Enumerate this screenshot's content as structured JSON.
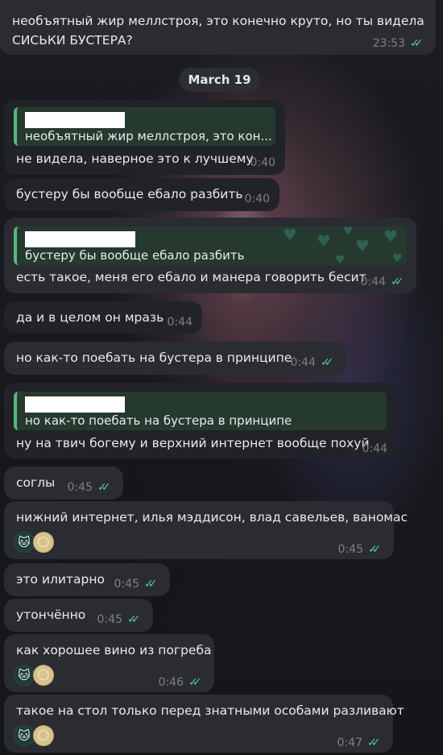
{
  "messages": [
    {
      "text_line1": "необъятный жир меллстроя, это конечно круто, но ты видела",
      "text_line2": "СИСЬКИ БУСТЕРА?",
      "time": "23:53"
    },
    {
      "quote": "необъятный жир меллстроя, это кон...",
      "text": "не видела, наверное это к лучшему",
      "time": "0:40"
    },
    {
      "text": "бустеру бы вообще ебало разбить",
      "time": "0:40"
    },
    {
      "quote": "бустеру бы вообще ебало разбить",
      "text": "есть такое, меня его ебало и манера говорить бесит",
      "time": "0:44"
    },
    {
      "text": "да и в целом он мразь",
      "time": "0:44"
    },
    {
      "text": "но как-то поебать на бустера в принципе",
      "time": "0:44"
    },
    {
      "quote": "но как-то поебать на бустера в принципе",
      "text": "ну на твич богему и верхний интернет вообще похуй",
      "time": "0:44"
    },
    {
      "text": "соглы",
      "time": "0:45"
    },
    {
      "text": "нижний интернет, илья мэддисон, влад савельев, ваномас",
      "time": "0:45"
    },
    {
      "text": "это илитарно",
      "time": "0:45"
    },
    {
      "text": "утончённо",
      "time": "0:45"
    },
    {
      "text": "как хорошее вино из погреба",
      "time": "0:46"
    },
    {
      "text": "такое на стол только перед знатными особами разливают",
      "time": "0:47"
    }
  ],
  "date_separator": "March 19",
  "icons": {
    "read": "double-check-icon",
    "reaction1": "hello-kitty-emoji",
    "reaction2": "moon-emoji"
  },
  "colors": {
    "check": "#4fcf90",
    "reply_bar": "#55b97a"
  }
}
